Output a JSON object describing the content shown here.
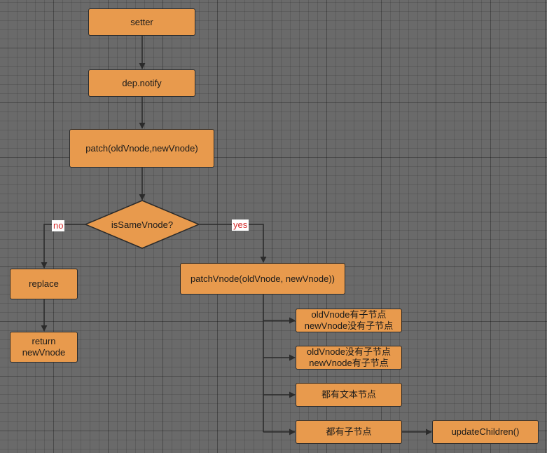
{
  "nodes": {
    "setter": "setter",
    "dep_notify": "dep.notify",
    "patch": "patch(oldVnode,newVnode)",
    "is_same_vnode": "isSameVnode?",
    "replace": "replace",
    "return_line1": "return",
    "return_line2": "newVnode",
    "patch_vnode": "patchVnode(oldVnode, newVnode))",
    "case1_line1": "oldVnode有子节点",
    "case1_line2": "newVnode没有子节点",
    "case2_line1": "oldVnode没有子节点",
    "case2_line2": "newVnode有子节点",
    "case3": "都有文本节点",
    "case4": "都有子节点",
    "update_children": "updateChildren()"
  },
  "edge_labels": {
    "no": "no",
    "yes": "yes"
  },
  "colors": {
    "node_fill": "#e89a4d",
    "stroke": "#2b2b2b",
    "label_text": "#d42b2b",
    "background": "#6a6a6a"
  }
}
